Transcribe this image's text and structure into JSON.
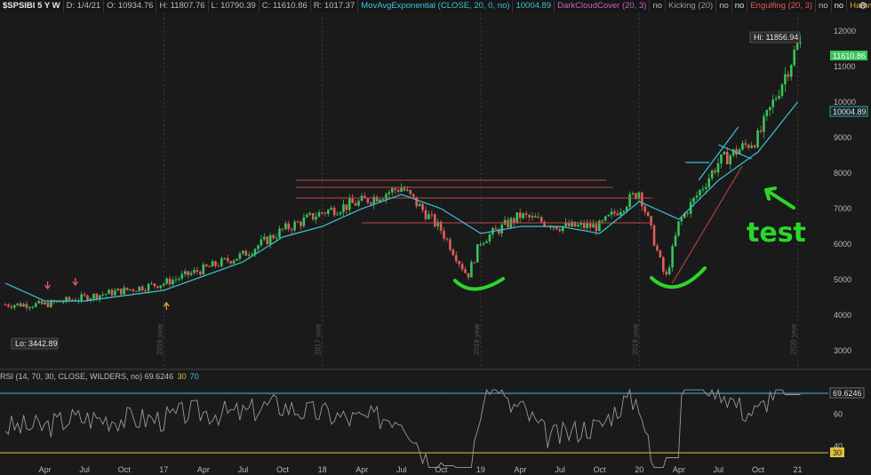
{
  "header": {
    "symbol": "$SPSIBI 5 Y W",
    "date": "D: 1/4/21",
    "open": "O: 10934.76",
    "high": "H: 11807.76",
    "low": "L: 10790.39",
    "close": "C: 11610.86",
    "range": "R: 1017.37",
    "ema_label": "MovAvgExponential (CLOSE, 20, 0, no)",
    "ema_value": "10004.89",
    "dcc_label": "DarkCloudCover (20, 3)",
    "dcc_value": "no",
    "kicking_label": "Kicking (20)",
    "kicking_value1": "no",
    "kicking_value2": "no",
    "engulfing_label": "Engulfing (20, 3)",
    "engulfing_value1": "no",
    "engulfing_value2": "no",
    "hammer_label": "Hammer (20, 3,...",
    "settings_icon": "gear-icon"
  },
  "rsi_header": {
    "label": "RSI (14, 70, 30, CLOSE, WILDERS, no)",
    "value": "69.6246",
    "oversold": "30",
    "overbought": "70"
  },
  "annotations": {
    "hi_label": "Hi: 11856.94",
    "lo_label": "Lo: 3442.89",
    "test_text": "test",
    "last_price": "11610.86",
    "ema_price": "10004.89",
    "rsi_price": "69.6246",
    "rsi_30_tag": "30"
  },
  "colors": {
    "background": "#1a1a1a",
    "up": "#39c25a",
    "down": "#e25c5c",
    "ema": "#3fc3d6",
    "rsi": "#9a9a9a",
    "overbought": "#3fc3d6",
    "oversold": "#e0c23a",
    "resistance": "#c04848",
    "marker": "#2bd62b"
  },
  "chart_data": [
    {
      "type": "candlestick",
      "title": "$SPSIBI 5 Y W",
      "x_ticks": [
        "Apr",
        "Jul",
        "Oct",
        "17",
        "Apr",
        "Jul",
        "Oct",
        "18",
        "Apr",
        "Jul",
        "Oct",
        "19",
        "Apr",
        "Jul",
        "Oct",
        "20",
        "Apr",
        "Jul",
        "Oct",
        "21"
      ],
      "year_markers": [
        "2016 year",
        "2017 year",
        "2018 year",
        "2019 year",
        "2020 year"
      ],
      "y_ticks": [
        3000,
        4000,
        5000,
        6000,
        7000,
        8000,
        9000,
        10000,
        11000,
        12000
      ],
      "ylim": [
        2500,
        12500
      ],
      "series": [
        {
          "name": "close",
          "x": [
            "2016-01",
            "2016-04",
            "2016-07",
            "2016-10",
            "2017-01",
            "2017-04",
            "2017-07",
            "2017-10",
            "2018-01",
            "2018-04",
            "2018-07",
            "2018-10",
            "2018-12",
            "2019-01",
            "2019-04",
            "2019-07",
            "2019-10",
            "2020-01",
            "2020-03",
            "2020-04",
            "2020-07",
            "2020-10",
            "2021-01"
          ],
          "values": [
            4300,
            4300,
            4500,
            4700,
            4900,
            5300,
            5700,
            6400,
            6900,
            7200,
            7600,
            6400,
            5100,
            6100,
            6800,
            6500,
            6500,
            7500,
            5000,
            6600,
            8300,
            9000,
            11610
          ]
        },
        {
          "name": "MovAvgExponential",
          "x": [
            "2016-01",
            "2016-04",
            "2016-07",
            "2016-10",
            "2017-01",
            "2017-04",
            "2017-07",
            "2017-10",
            "2018-01",
            "2018-04",
            "2018-07",
            "2018-10",
            "2019-01",
            "2019-04",
            "2019-07",
            "2019-10",
            "2020-01",
            "2020-04",
            "2020-07",
            "2020-10",
            "2021-01"
          ],
          "values": [
            4900,
            4400,
            4400,
            4550,
            4700,
            5100,
            5500,
            6200,
            6500,
            7000,
            7400,
            7000,
            6300,
            6500,
            6500,
            6300,
            7200,
            6700,
            7800,
            8600,
            10004.89
          ]
        }
      ],
      "hi": 11856.94,
      "lo": 3442.89,
      "resistance_levels": [
        7800,
        7600,
        7300,
        6600
      ]
    },
    {
      "type": "line",
      "title": "RSI (14, 70, 30, CLOSE, WILDERS, no)",
      "y_ticks": [
        40,
        60
      ],
      "ylim": [
        25,
        80
      ],
      "overbought": 70,
      "oversold": 30,
      "last": 69.6246
    }
  ]
}
